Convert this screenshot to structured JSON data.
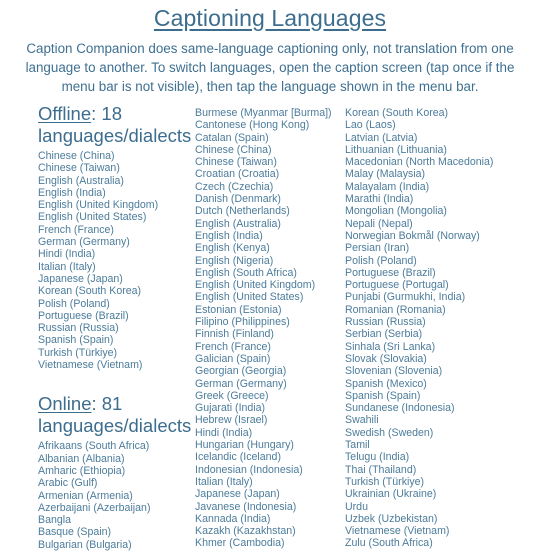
{
  "header": {
    "title": "Captioning Languages",
    "intro": "Caption Companion does same-language captioning only, not translation from one language to another. To switch languages, open the caption screen (tap once if the menu bar is not visible), then tap the language shown in the menu bar."
  },
  "theme": {
    "accent": "#3c6d8e",
    "body_text": "#3f7091",
    "list_text": "#4c7c9b",
    "background": "#ffffff"
  },
  "offline": {
    "keyword": "Offline",
    "count": "18",
    "heading_suffix": ": 18 languages/dialects",
    "languages": [
      "Chinese (China)",
      "Chinese (Taiwan)",
      "English (Australia)",
      "English (India)",
      "English (United Kingdom)",
      "English (United States)",
      "French (France)",
      "German (Germany)",
      "Hindi (India)",
      "Italian (Italy)",
      "Japanese (Japan)",
      "Korean (South Korea)",
      "Polish (Poland)",
      "Portuguese (Brazil)",
      "Russian (Russia)",
      "Spanish (Spain)",
      "Turkish (Türkiye)",
      "Vietnamese (Vietnam)"
    ]
  },
  "online": {
    "keyword": "Online",
    "count": "81",
    "heading_suffix": ": 81 languages/dialects",
    "languages_col1": [
      "Afrikaans (South Africa)",
      "Albanian (Albania)",
      "Amharic (Ethiopia)",
      "Arabic (Gulf)",
      "Armenian (Armenia)",
      "Azerbaijani (Azerbaijan)",
      "Bangla",
      "Basque (Spain)",
      "Bulgarian (Bulgaria)"
    ],
    "languages_col2": [
      "Burmese (Myanmar [Burma])",
      "Cantonese (Hong Kong)",
      "Catalan (Spain)",
      "Chinese (China)",
      "Chinese (Taiwan)",
      "Croatian (Croatia)",
      "Czech (Czechia)",
      "Danish (Denmark)",
      "Dutch (Netherlands)",
      "English (Australia)",
      "English (India)",
      "English (Kenya)",
      "English (Nigeria)",
      "English (South Africa)",
      "English (United Kingdom)",
      "English (United States)",
      "Estonian (Estonia)",
      "Filipino (Philippines)",
      "Finnish (Finland)",
      "French (France)",
      "Galician (Spain)",
      "Georgian (Georgia)",
      "German (Germany)",
      "Greek (Greece)",
      "Gujarati (India)",
      "Hebrew (Israel)",
      "Hindi (India)",
      "Hungarian (Hungary)",
      "Icelandic (Iceland)",
      "Indonesian (Indonesia)",
      "Italian (Italy)",
      "Japanese (Japan)",
      "Javanese (Indonesia)",
      "Kannada (India)",
      "Kazakh (Kazakhstan)",
      "Khmer (Cambodia)"
    ],
    "languages_col3": [
      "Korean (South Korea)",
      "Lao (Laos)",
      "Latvian (Latvia)",
      "Lithuanian (Lithuania)",
      "Macedonian (North Macedonia)",
      "Malay (Malaysia)",
      "Malayalam (India)",
      "Marathi (India)",
      "Mongolian (Mongolia)",
      "Nepali (Nepal)",
      "Norwegian Bokmål (Norway)",
      "Persian (Iran)",
      "Polish (Poland)",
      "Portuguese (Brazil)",
      "Portuguese (Portugal)",
      "Punjabi (Gurmukhi, India)",
      "Romanian (Romania)",
      "Russian (Russia)",
      "Serbian (Serbia)",
      "Sinhala (Sri Lanka)",
      "Slovak (Slovakia)",
      "Slovenian (Slovenia)",
      "Spanish (Mexico)",
      "Spanish (Spain)",
      "Sundanese (Indonesia)",
      "Swahili",
      "Swedish (Sweden)",
      "Tamil",
      "Telugu (India)",
      "Thai (Thailand)",
      "Turkish (Türkiye)",
      "Ukrainian (Ukraine)",
      "Urdu",
      "Uzbek (Uzbekistan)",
      "Vietnamese (Vietnam)",
      "Zulu (South Africa)"
    ]
  }
}
